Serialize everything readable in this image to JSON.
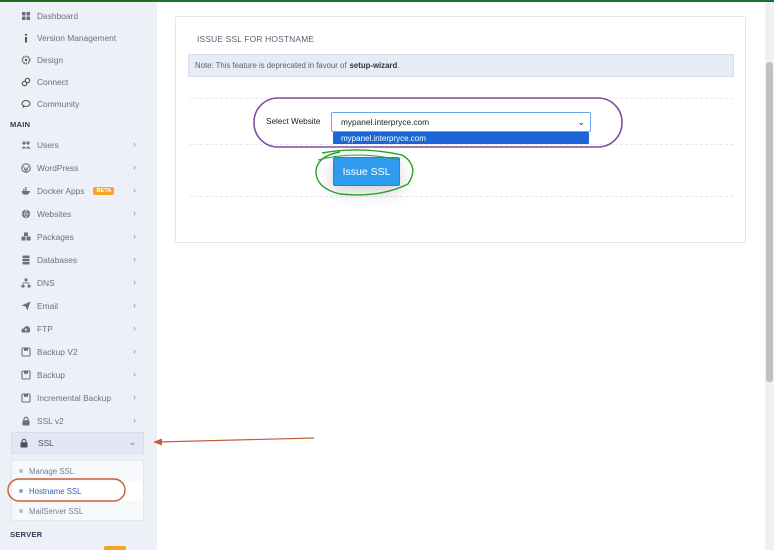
{
  "sidebar": {
    "top_items": [
      {
        "label": "Dashboard",
        "icon": "dashboard-icon"
      },
      {
        "label": "Version Management",
        "icon": "info-icon"
      },
      {
        "label": "Design",
        "icon": "gear-icon"
      },
      {
        "label": "Connect",
        "icon": "link-icon"
      },
      {
        "label": "Community",
        "icon": "chat-icon"
      }
    ],
    "main_section_label": "MAIN",
    "main_items": [
      {
        "label": "Users",
        "icon": "users-icon"
      },
      {
        "label": "WordPress",
        "icon": "wordpress-icon"
      },
      {
        "label": "Docker Apps",
        "icon": "docker-icon",
        "badge": "BETA"
      },
      {
        "label": "Websites",
        "icon": "globe-icon"
      },
      {
        "label": "Packages",
        "icon": "packages-icon"
      },
      {
        "label": "Databases",
        "icon": "database-icon"
      },
      {
        "label": "DNS",
        "icon": "sitemap-icon"
      },
      {
        "label": "Email",
        "icon": "paper-plane-icon"
      },
      {
        "label": "FTP",
        "icon": "cloud-upload-icon"
      },
      {
        "label": "Backup V2",
        "icon": "backup-icon"
      },
      {
        "label": "Backup",
        "icon": "backup-icon"
      },
      {
        "label": "Incremental Backup",
        "icon": "backup-icon"
      },
      {
        "label": "SSL v2",
        "icon": "lock-icon"
      }
    ],
    "ssl_item": {
      "label": "SSL",
      "icon": "lock-icon"
    },
    "ssl_submenu": [
      {
        "label": "Manage SSL"
      },
      {
        "label": "Hostname SSL"
      },
      {
        "label": "MailServer SSL"
      }
    ],
    "server_section_label": "SERVER"
  },
  "panel": {
    "title": "ISSUE SSL FOR HOSTNAME",
    "note_prefix": "Note: This feature is deprecated in favour of",
    "note_link": "setup-wizard",
    "note_suffix": ".",
    "select_label": "Select Website",
    "select_value": "mypanel.interpryce.com",
    "dropdown_options": [
      "mypanel.interpryce.com"
    ],
    "issue_button": "Issue SSL"
  },
  "colors": {
    "accent_blue": "#2f9cf0",
    "annotation_purple": "#7b4fa0",
    "annotation_green": "#2aa12a",
    "annotation_red": "#c2603a",
    "beta_badge": "#f5a623"
  }
}
